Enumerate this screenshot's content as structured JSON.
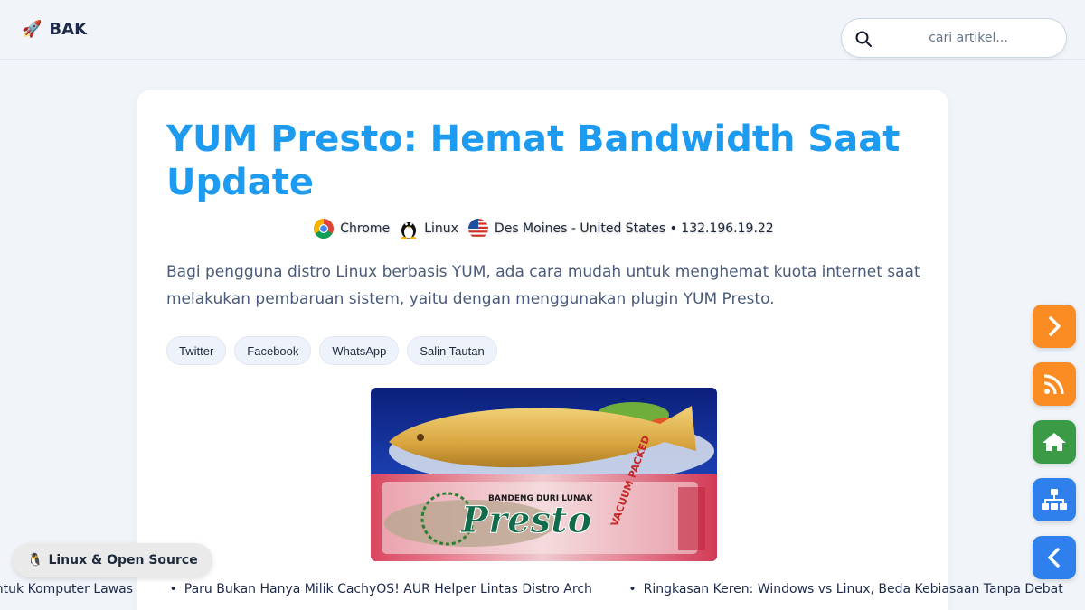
{
  "header": {
    "brand": "BAK",
    "search_placeholder": "cari artikel..."
  },
  "article": {
    "title": "YUM Presto: Hemat Bandwidth Saat Update",
    "meta": {
      "browser": "Chrome",
      "os": "Linux",
      "location": "Des Moines - United States • 132.196.19.22"
    },
    "lead": "Bagi pengguna distro Linux berbasis YUM, ada cara mudah untuk menghemat kuota internet saat melakukan pembaruan sistem, yaitu dengan menggunakan plugin YUM Presto.",
    "share_buttons": [
      "Twitter",
      "Facebook",
      "WhatsApp",
      "Salin Tautan"
    ],
    "image": {
      "package_text": "Presto",
      "package_subtext": "BANDENG DURI LUNAK",
      "badge_text": "VACUUM PACKED"
    }
  },
  "floating_buttons": [
    {
      "icon": "chevron-right-icon",
      "color": "#f97316"
    },
    {
      "icon": "rss-icon",
      "color": "#f97316"
    },
    {
      "icon": "home-icon",
      "color": "#3a9a46"
    },
    {
      "icon": "sitemap-icon",
      "color": "#2f80ed"
    },
    {
      "icon": "chevron-left-icon",
      "color": "#2f80ed"
    }
  ],
  "category_pill": "Linux & Open Source",
  "ticker": [
    "baik untuk Komputer Lawas",
    "Paru Bukan Hanya Milik CachyOS! AUR Helper Lintas Distro Arch",
    "Ringkasan Keren: Windows vs Linux, Beda Kebiasaan Tanpa Debat"
  ]
}
